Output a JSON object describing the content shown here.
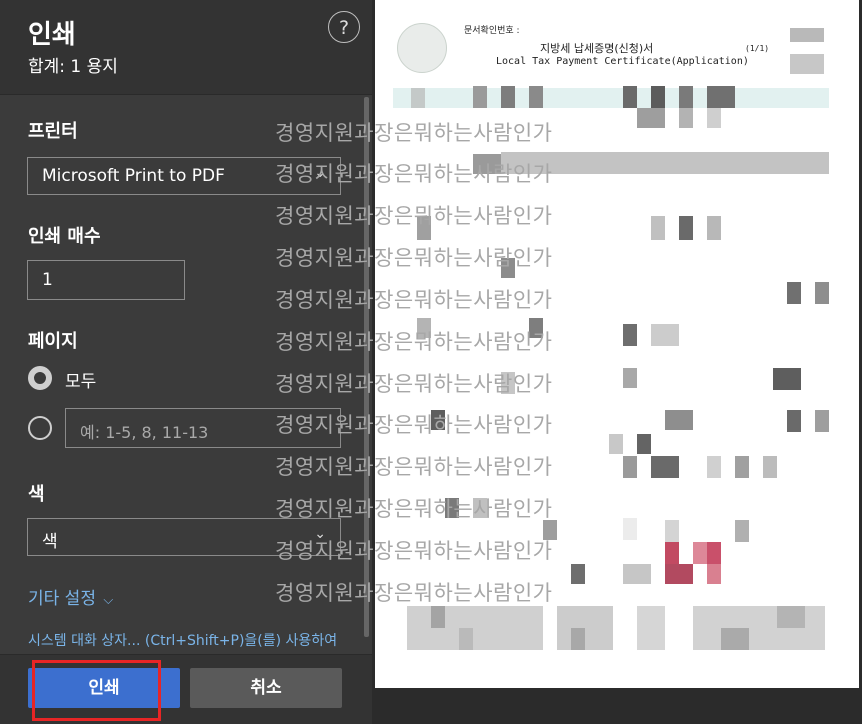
{
  "header": {
    "title": "인쇄",
    "subtitle": "합계: 1 용지",
    "help_symbol": "?"
  },
  "printer": {
    "label": "프린터",
    "value": "Microsoft Print to PDF"
  },
  "copies": {
    "label": "인쇄 매수",
    "value": "1"
  },
  "pages": {
    "label": "페이지",
    "option_all": "모두",
    "custom_placeholder": "예: 1-5, 8, 11-13"
  },
  "color": {
    "label": "색",
    "value": "색"
  },
  "more_settings": {
    "label": "기타 설정",
    "chevron": "⌵"
  },
  "system_dialog": {
    "label": "시스템 대화 상자... (Ctrl+Shift+P)을(를) 사용하여"
  },
  "buttons": {
    "print": "인쇄",
    "cancel": "취소"
  },
  "preview": {
    "doc_number_label": "문서확인번호 :",
    "title_ko": "지방세 납세증명(신청)서",
    "title_en": "Local Tax Payment Certificate(Application)",
    "page_indicator": "(1/1)",
    "watermark_lines": [
      "경영지원과장은뭐하는사람인가",
      "경영지원과장은뭐하는사람인가",
      "경영지원과장은뭐하는사람인가",
      "경영지원과장은뭐하는사람인가",
      "경영지원과장은뭐하는사람인가",
      "경영지원과장은뭐하는사람인가",
      "경영지원과장은뭐하는사람인가",
      "경영지원과장은뭐하는사람인가",
      "경영지원과장은뭐하는사람인가",
      "경영지원과장은뭐하는사람인가",
      "경영지원과장은뭐하는사람인가",
      "경영지원과장은뭐하는사람인가"
    ]
  },
  "colors": {
    "accent": "#3c6fcf",
    "link": "#7ab4e8",
    "highlight": "#e82525",
    "panel": "#3b3b3b"
  }
}
